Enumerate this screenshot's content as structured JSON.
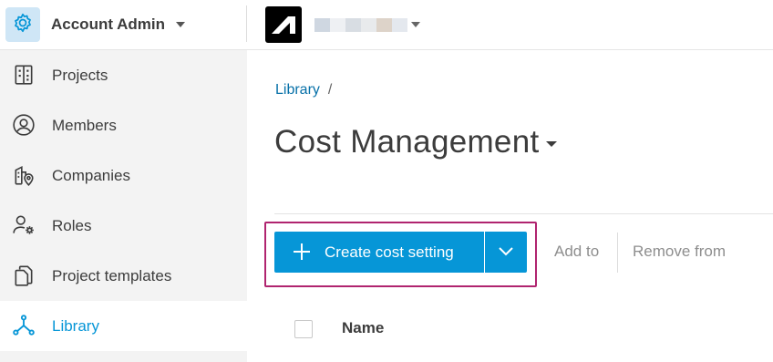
{
  "account": {
    "title": "Account Admin",
    "icon": "gear-icon",
    "icon_bg": "#cfe6f6",
    "accent": "#0696d7"
  },
  "topbar": {
    "logo": "autodesk-logo-icon",
    "project_selector_blurred": true
  },
  "sidebar": {
    "items": [
      {
        "label": "Projects",
        "icon": "building-icon",
        "active": false
      },
      {
        "label": "Members",
        "icon": "user-circle-icon",
        "active": false
      },
      {
        "label": "Companies",
        "icon": "company-location-icon",
        "active": false
      },
      {
        "label": "Roles",
        "icon": "user-gear-icon",
        "active": false
      },
      {
        "label": "Project templates",
        "icon": "templates-icon",
        "active": false
      },
      {
        "label": "Library",
        "icon": "network-icon",
        "active": true
      }
    ]
  },
  "breadcrumb": {
    "items": [
      "Library"
    ],
    "separator": "/"
  },
  "page": {
    "title": "Cost Management"
  },
  "toolbar": {
    "create_label": "Create cost setting",
    "add_to_label": "Add to",
    "remove_from_label": "Remove from",
    "highlight_color": "#b0246f",
    "button_color": "#0696d7"
  },
  "table": {
    "columns": [
      "Name"
    ]
  }
}
